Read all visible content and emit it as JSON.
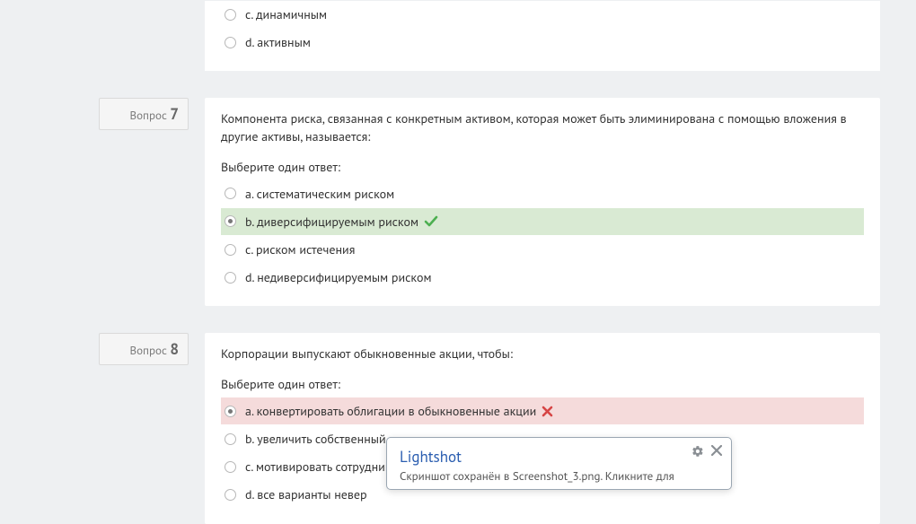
{
  "question_label": "Вопрос",
  "select_prompt": "Выберите один ответ:",
  "trailing": {
    "options": [
      {
        "letter": "c",
        "text": "динамичным",
        "selected": false,
        "state": "none"
      },
      {
        "letter": "d",
        "text": "активным",
        "selected": false,
        "state": "none"
      }
    ]
  },
  "q7": {
    "number": "7",
    "text": "Компонента риска, связанная с конкретным активом, которая может быть элиминирована с помощью вложения в другие активы, называется:",
    "options": [
      {
        "letter": "a",
        "text": "систематическим риском",
        "selected": false,
        "state": "none"
      },
      {
        "letter": "b",
        "text": "диверсифицируемым риском",
        "selected": true,
        "state": "correct"
      },
      {
        "letter": "c",
        "text": "риском истечения",
        "selected": false,
        "state": "none"
      },
      {
        "letter": "d",
        "text": "недиверсифицируемым риском",
        "selected": false,
        "state": "none"
      }
    ]
  },
  "q8": {
    "number": "8",
    "text": "Корпорации выпускают обыкновенные акции, чтобы:",
    "options": [
      {
        "letter": "a",
        "text": "конвертировать облигации в обыкновенные акции",
        "selected": true,
        "state": "incorrect"
      },
      {
        "letter": "b",
        "text": "увеличить собственный капитал",
        "selected": false,
        "state": "none"
      },
      {
        "letter": "c",
        "text": "мотивировать сотрудников",
        "selected": false,
        "state": "none"
      },
      {
        "letter": "d",
        "text": "все варианты невер",
        "selected": false,
        "state": "none"
      }
    ]
  },
  "popup": {
    "title": "Lightshot",
    "subtitle": "Скриншот сохранён в Screenshot_3.png. Кликните для"
  }
}
